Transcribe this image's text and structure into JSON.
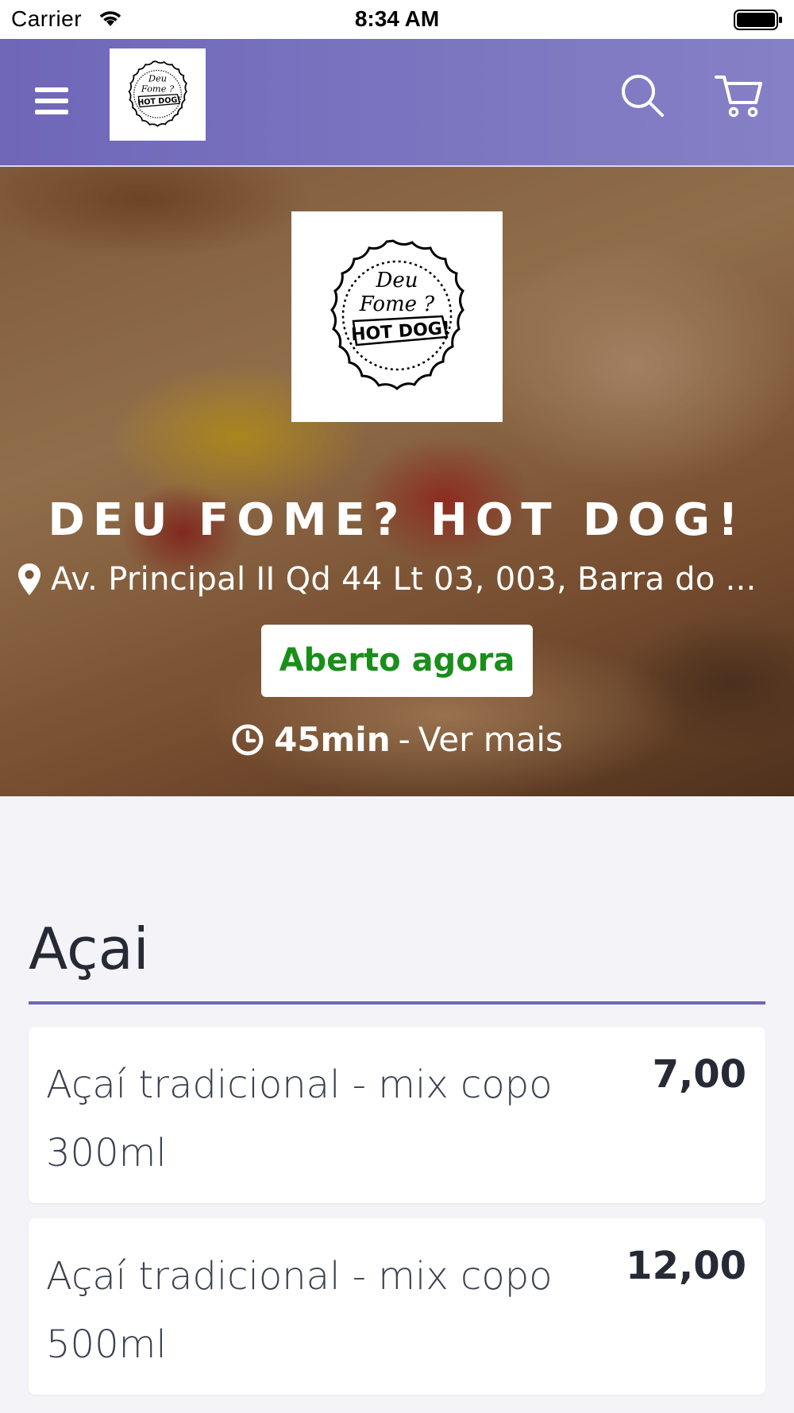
{
  "status_bar": {
    "carrier": "Carrier",
    "time": "8:34 AM"
  },
  "navbar": {
    "menu_icon": "hamburger-menu-icon",
    "logo_text": [
      "Deu",
      "Fome ?",
      "HOT DOG!"
    ],
    "search_icon": "search-icon",
    "cart_icon": "cart-icon",
    "background_color": "#7a74c0"
  },
  "hero": {
    "logo_text": [
      "Deu",
      "Fome ?",
      "HOT DOG!"
    ],
    "restaurant_name": "DEU FOME? HOT DOG!",
    "address": "Av. Principal II Qd 44 Lt 03, 003, Barra do ...",
    "open_status": "Aberto agora",
    "open_status_color": "#1a8e1a",
    "delivery_time": "45min",
    "delivery_separator": "-",
    "see_more": "Ver mais"
  },
  "menu": {
    "section_title": "Açai",
    "accent_color": "#6f66b8",
    "items": [
      {
        "name": "Açaí tradicional - mix copo 300ml",
        "price": "7,00"
      },
      {
        "name": "Açaí tradicional - mix copo 500ml",
        "price": "12,00"
      }
    ]
  }
}
